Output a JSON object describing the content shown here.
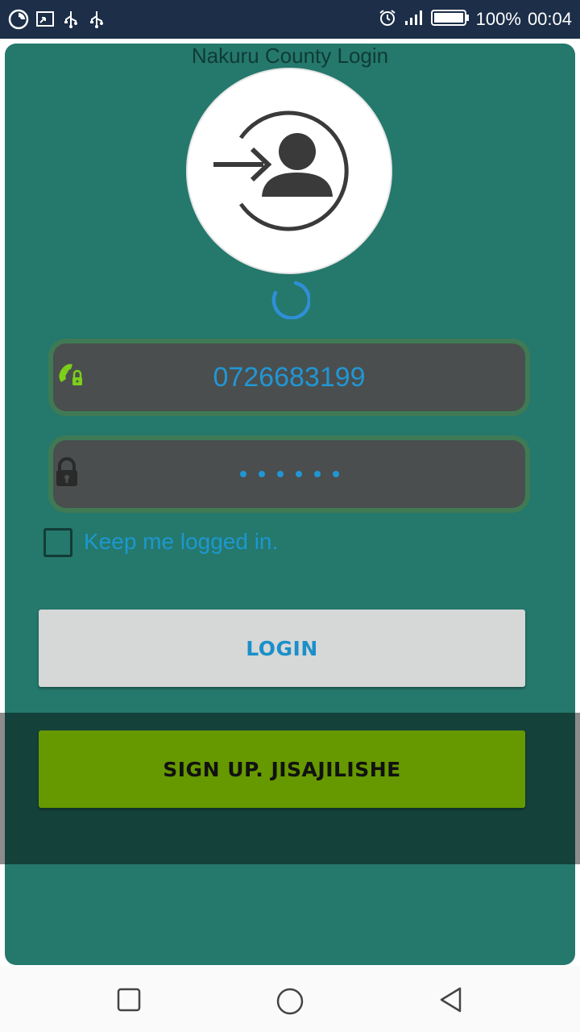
{
  "status_bar": {
    "battery_percent": "100%",
    "time": "00:04",
    "icons": [
      "app-icon",
      "cast-icon",
      "usb-icon",
      "usb-icon",
      "alarm-icon",
      "signal-icon",
      "battery-icon"
    ]
  },
  "login": {
    "title": "Nakuru County Login",
    "phone_value": "0726683199",
    "password_masked": "••••••",
    "keep_logged_in_label": "Keep me logged in.",
    "keep_logged_in_checked": false,
    "login_button": "LOGIN",
    "signup_button": "SIGN UP. JISAJILISHE"
  },
  "nav_bar": {
    "buttons": [
      "recents-button",
      "home-button",
      "back-button"
    ]
  },
  "colors": {
    "status_bar": "#1c2e48",
    "card_background": "#25786c",
    "field_border": "#3f7a55",
    "field_fill": "#4a4e4e",
    "accent_blue": "#2196d3",
    "signup_green": "#669900",
    "login_button_bg": "#d6d7d7"
  }
}
